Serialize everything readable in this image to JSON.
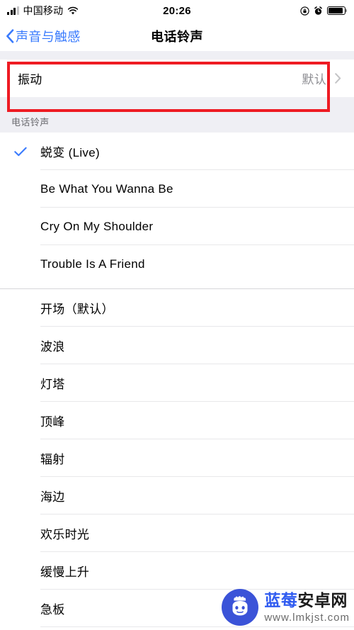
{
  "status_bar": {
    "carrier": "中国移动",
    "time": "20:26",
    "icons": {
      "signal": "signal-bars-icon",
      "wifi": "wifi-icon",
      "rotation_lock": "rotation-lock-icon",
      "alarm": "alarm-clock-icon",
      "battery": "battery-icon"
    }
  },
  "nav": {
    "back_label": "声音与触感",
    "title": "电话铃声"
  },
  "vibration": {
    "label": "振动",
    "value": "默认",
    "highlight_color": "#ee1b23"
  },
  "section": {
    "header": "电话铃声"
  },
  "tones": {
    "custom": [
      {
        "name": "蜕变 (Live)",
        "selected": true
      },
      {
        "name": "Be What You Wanna Be",
        "selected": false
      },
      {
        "name": "Cry On My Shoulder",
        "selected": false
      },
      {
        "name": "Trouble Is A Friend",
        "selected": false
      }
    ],
    "builtin": [
      {
        "name": "开场（默认）",
        "selected": false
      },
      {
        "name": "波浪",
        "selected": false
      },
      {
        "name": "灯塔",
        "selected": false
      },
      {
        "name": "顶峰",
        "selected": false
      },
      {
        "name": "辐射",
        "selected": false
      },
      {
        "name": "海边",
        "selected": false
      },
      {
        "name": "欢乐时光",
        "selected": false
      },
      {
        "name": "缓慢上升",
        "selected": false
      },
      {
        "name": "急板",
        "selected": false
      }
    ]
  },
  "watermark": {
    "title_blue": "蓝莓",
    "title_dark": "安卓网",
    "url": "www.lmkjst.com",
    "logo": "android-berry-logo-icon",
    "brand_color": "#3b53d8"
  },
  "theme": {
    "accent": "#3a7bfd",
    "group_bg": "#efeff4",
    "separator": "#e2e2e5",
    "secondary_text": "#8e8e93"
  }
}
